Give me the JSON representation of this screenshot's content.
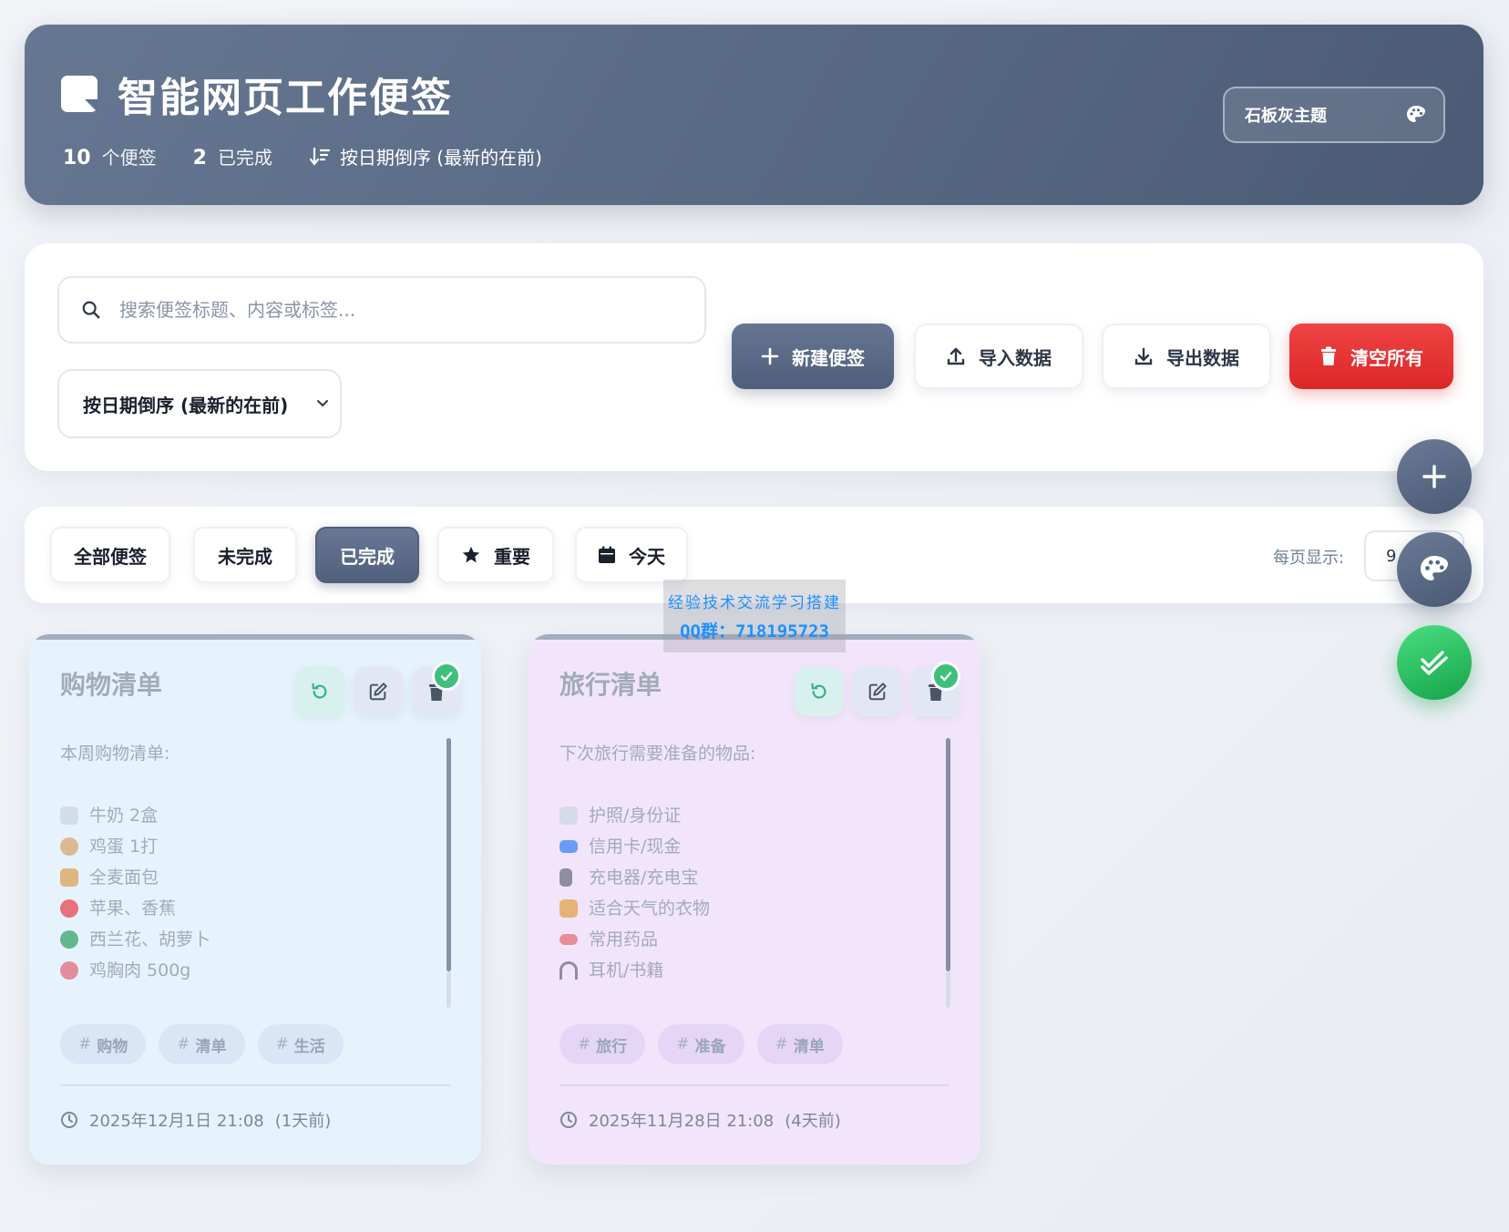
{
  "header": {
    "title": "智能网页工作便签",
    "stats": [
      {
        "num": "10",
        "label": "个便签"
      },
      {
        "num": "2",
        "label": "已完成"
      }
    ],
    "sort_text": "按日期倒序 (最新的在前)",
    "theme_button": "石板灰主题"
  },
  "toolbar": {
    "search_placeholder": "搜索便签标题、内容或标签...",
    "sort_select": "按日期倒序 (最新的在前)",
    "new_note": "新建便签",
    "import": "导入数据",
    "export": "导出数据",
    "clear": "清空所有"
  },
  "filters": {
    "chips": [
      "全部便签",
      "未完成",
      "已完成",
      "重要",
      "今天"
    ],
    "active": "已完成",
    "per_page_label": "每页显示:",
    "per_page_value": "9"
  },
  "watermark": {
    "line1": "经验技术交流学习搭建",
    "line2": "QQ群：718195723"
  },
  "notes": [
    {
      "title": "购物清单",
      "intro": "本周购物清单:",
      "items": [
        {
          "icon": "milk-glass-icon",
          "color": "#cbd5e1",
          "text": "牛奶 2盒"
        },
        {
          "icon": "egg-icon",
          "color": "#d8a56e",
          "text": "鸡蛋 1打"
        },
        {
          "icon": "bread-box-icon",
          "color": "#d9a15a",
          "text": "全麦面包"
        },
        {
          "icon": "apple-icon",
          "color": "#e5484d",
          "text": "苹果、香蕉"
        },
        {
          "icon": "broccoli-icon",
          "color": "#3aa169",
          "text": "西兰花、胡萝卜"
        },
        {
          "icon": "meat-icon",
          "color": "#e06b7a",
          "text": "鸡胸肉 500g"
        }
      ],
      "tags": [
        "购物",
        "清单",
        "生活"
      ],
      "date": "2025年12月1日 21:08",
      "relative": "(1天前)",
      "completed": true,
      "bg": "#e6f3fc"
    },
    {
      "title": "旅行清单",
      "intro": "下次旅行需要准备的物品:",
      "items": [
        {
          "icon": "document-icon",
          "color": "#cbd5e1",
          "text": "护照/身份证"
        },
        {
          "icon": "credit-card-icon",
          "color": "#3b82f6",
          "text": "信用卡/现金"
        },
        {
          "icon": "power-bank-icon",
          "color": "#6b7280",
          "text": "充电器/充电宝"
        },
        {
          "icon": "clothes-icon",
          "color": "#e3a04a",
          "text": "适合天气的衣物"
        },
        {
          "icon": "pill-icon",
          "color": "#e0707a",
          "text": "常用药品"
        },
        {
          "icon": "headphones-icon",
          "color": "#6b7280",
          "text": "耳机/书籍"
        }
      ],
      "tags": [
        "旅行",
        "准备",
        "清单"
      ],
      "date": "2025年11月28日 21:08",
      "relative": "(4天前)",
      "completed": true,
      "bg": "#f2e5fb"
    }
  ],
  "colors": {
    "header_bg": "#5a6b86",
    "accent": "#51617d",
    "danger": "#dc2626",
    "success": "#16a34a"
  }
}
